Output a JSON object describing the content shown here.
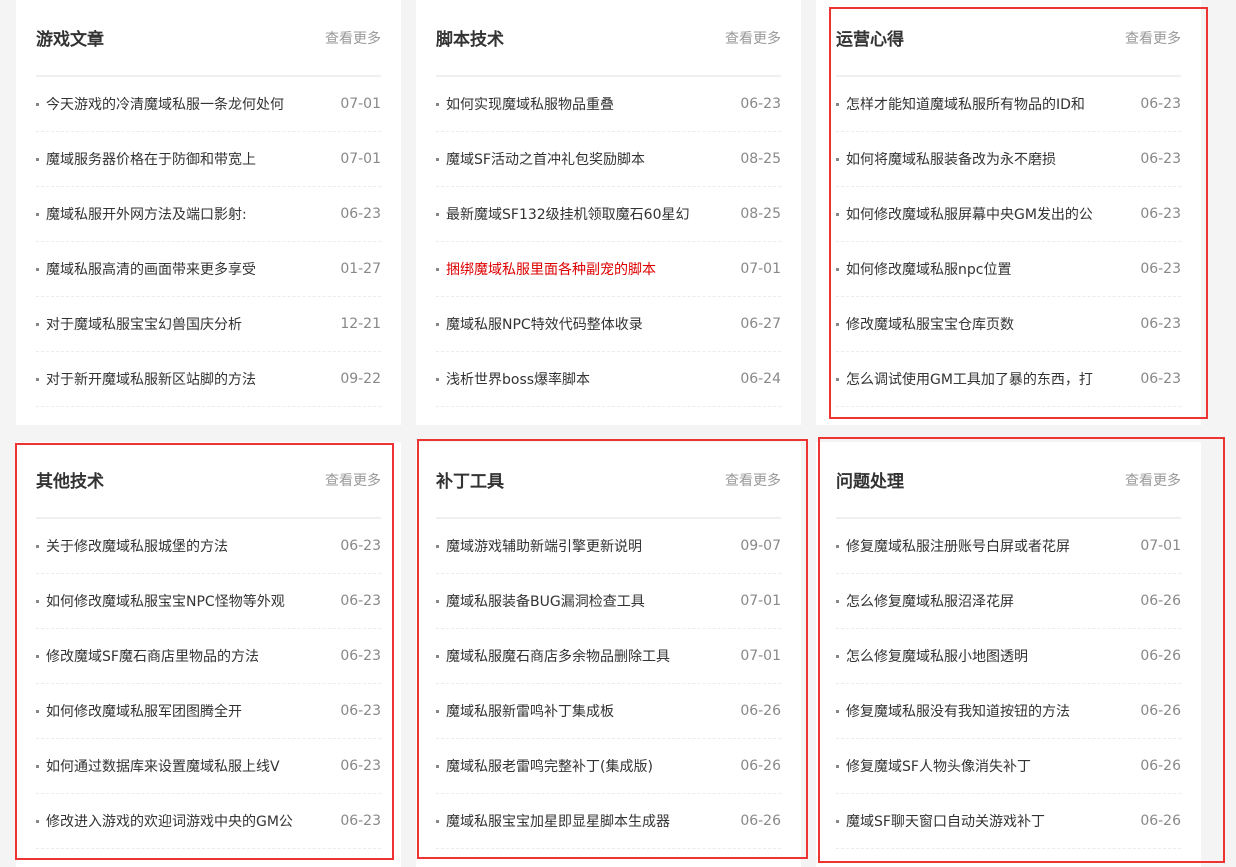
{
  "panels": [
    {
      "title": "游戏文章",
      "more": "查看更多",
      "items": [
        {
          "text": "今天游戏的冷清魔域私服一条龙何处何",
          "date": "07-01"
        },
        {
          "text": "魔域服务器价格在于防御和带宽上",
          "date": "07-01"
        },
        {
          "text": "魔域私服开外网方法及端口影射:",
          "date": "06-23"
        },
        {
          "text": "魔域私服高清的画面带来更多享受",
          "date": "01-27"
        },
        {
          "text": "对于魔域私服宝宝幻兽国庆分析",
          "date": "12-21"
        },
        {
          "text": "对于新开魔域私服新区站脚的方法",
          "date": "09-22"
        }
      ]
    },
    {
      "title": "脚本技术",
      "more": "查看更多",
      "items": [
        {
          "text": "如何实现魔域私服物品重叠",
          "date": "06-23"
        },
        {
          "text": "魔域SF活动之首冲礼包奖励脚本",
          "date": "08-25"
        },
        {
          "text": "最新魔域SF132级挂机领取魔石60星幻",
          "date": "08-25"
        },
        {
          "text": "捆绑魔域私服里面各种副宠的脚本",
          "date": "07-01",
          "highlight": true
        },
        {
          "text": "魔域私服NPC特效代码整体收录",
          "date": "06-27"
        },
        {
          "text": "浅析世界boss爆率脚本",
          "date": "06-24"
        }
      ]
    },
    {
      "title": "运营心得",
      "more": "查看更多",
      "items": [
        {
          "text": "怎样才能知道魔域私服所有物品的ID和",
          "date": "06-23"
        },
        {
          "text": "如何将魔域私服装备改为永不磨损",
          "date": "06-23"
        },
        {
          "text": "如何修改魔域私服屏幕中央GM发出的公",
          "date": "06-23"
        },
        {
          "text": "如何修改魔域私服npc位置",
          "date": "06-23"
        },
        {
          "text": "修改魔域私服宝宝仓库页数",
          "date": "06-23"
        },
        {
          "text": "怎么调试使用GM工具加了暴的东西，打",
          "date": "06-23"
        }
      ]
    },
    {
      "title": "其他技术",
      "more": "查看更多",
      "items": [
        {
          "text": "关于修改魔域私服城堡的方法",
          "date": "06-23"
        },
        {
          "text": "如何修改魔域私服宝宝NPC怪物等外观",
          "date": "06-23"
        },
        {
          "text": "修改魔域SF魔石商店里物品的方法",
          "date": "06-23"
        },
        {
          "text": "如何修改魔域私服军团图腾全开",
          "date": "06-23"
        },
        {
          "text": "如何通过数据库来设置魔域私服上线V",
          "date": "06-23"
        },
        {
          "text": "修改进入游戏的欢迎词游戏中央的GM公",
          "date": "06-23"
        }
      ]
    },
    {
      "title": "补丁工具",
      "more": "查看更多",
      "items": [
        {
          "text": "魔域游戏辅助新端引擎更新说明",
          "date": "09-07"
        },
        {
          "text": "魔域私服装备BUG漏洞检查工具",
          "date": "07-01"
        },
        {
          "text": "魔域私服魔石商店多余物品删除工具",
          "date": "07-01"
        },
        {
          "text": "魔域私服新雷鸣补丁集成板",
          "date": "06-26"
        },
        {
          "text": "魔域私服老雷鸣完整补丁(集成版)",
          "date": "06-26"
        },
        {
          "text": "魔域私服宝宝加星即显星脚本生成器",
          "date": "06-26"
        }
      ]
    },
    {
      "title": "问题处理",
      "more": "查看更多",
      "items": [
        {
          "text": "修复魔域私服注册账号白屏或者花屏",
          "date": "07-01"
        },
        {
          "text": "怎么修复魔域私服沼泽花屏",
          "date": "06-26"
        },
        {
          "text": "怎么修复魔域私服小地图透明",
          "date": "06-26"
        },
        {
          "text": "修复魔域私服没有我知道按钮的方法",
          "date": "06-26"
        },
        {
          "text": "修复魔域SF人物头像消失补丁",
          "date": "06-26"
        },
        {
          "text": "魔域SF聊天窗口自动关游戏补丁",
          "date": "06-26"
        }
      ]
    }
  ]
}
